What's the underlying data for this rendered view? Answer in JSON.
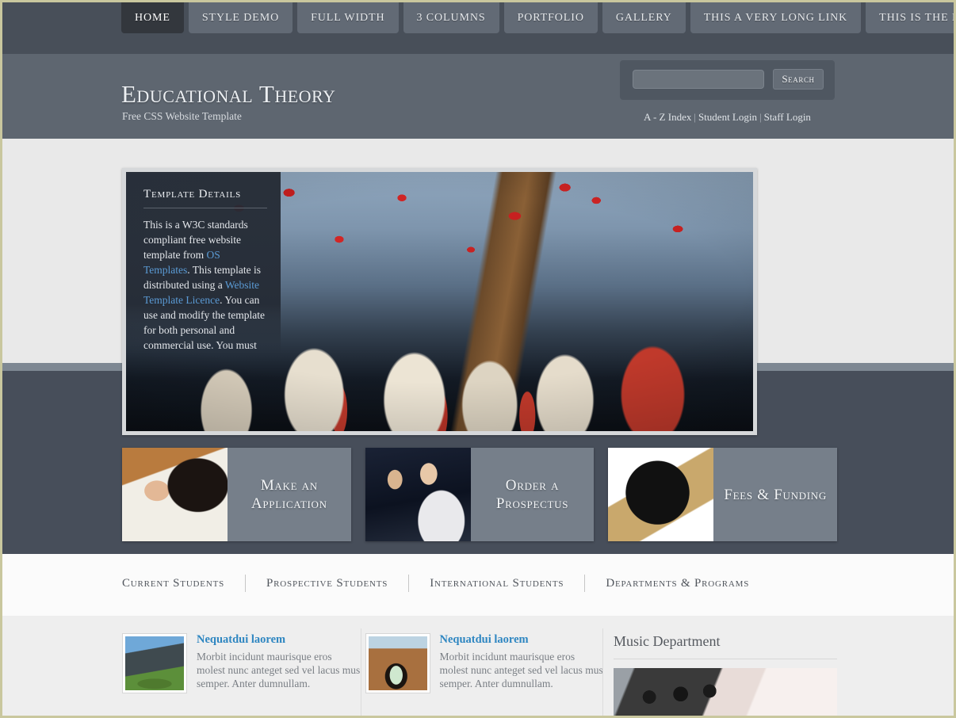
{
  "nav": {
    "items": [
      {
        "label": "Home",
        "active": true
      },
      {
        "label": "Style Demo",
        "active": false
      },
      {
        "label": "Full Width",
        "active": false
      },
      {
        "label": "3 Columns",
        "active": false
      },
      {
        "label": "Portfolio",
        "active": false
      },
      {
        "label": "Gallery",
        "active": false
      },
      {
        "label": "This a very long link",
        "active": false
      },
      {
        "label": "This is the last",
        "active": false
      }
    ]
  },
  "header": {
    "brand": "Educational Theory",
    "tagline": "Free CSS Website Template",
    "search": {
      "value": "",
      "placeholder": "",
      "button_label": "Search"
    },
    "toplinks": [
      {
        "label": "A - Z Index"
      },
      {
        "label": "Student Login"
      },
      {
        "label": "Staff Login"
      }
    ],
    "toplink_separator": "|"
  },
  "banner": {
    "details": {
      "heading": "Template Details",
      "text_1": "This is a W3C standards compliant free website template from ",
      "link_1": "OS Templates",
      "text_2": ". This template is distributed using a ",
      "link_2": "Website Template Licence",
      "text_3": ". You can use and modify the template for both personal and commercial use. You must keep all copyright information and all links in the template."
    }
  },
  "features": [
    {
      "label": "Make an Application",
      "image": "student-writing-photo"
    },
    {
      "label": "Order a Prospectus",
      "image": "students-laptop-photo"
    },
    {
      "label": "Fees & Funding",
      "image": "magnifier-money-photo"
    }
  ],
  "section_nav": [
    {
      "label": "Current Students"
    },
    {
      "label": "Prospective Students"
    },
    {
      "label": "International Students"
    },
    {
      "label": "Departments & Programs"
    }
  ],
  "footer": {
    "news": [
      {
        "title": "Nequatdui laorem",
        "text": "Morbit incidunt maurisque eros molest nunc anteget sed vel lacus mus semper. Anter dumnullam.",
        "thumb": "campus-lawn-photo"
      },
      {
        "title": "Nequatdui laorem",
        "text": "Morbit incidunt maurisque eros molest nunc anteget sed vel lacus mus semper. Anter dumnullam.",
        "thumb": "stone-archway-photo"
      }
    ],
    "department": {
      "title": "Music Department",
      "image": "clarinet-sheet-music-photo"
    }
  },
  "colors": {
    "nav_bg": "#484f59",
    "header_bg": "#5e6670",
    "band_light": "#e9e9e9",
    "band_dark": "#474e5a",
    "feature_panel": "#767f8a",
    "link_blue": "#2e86c1",
    "detail_link": "#5b9bd5",
    "page_border": "#c9c79e"
  }
}
